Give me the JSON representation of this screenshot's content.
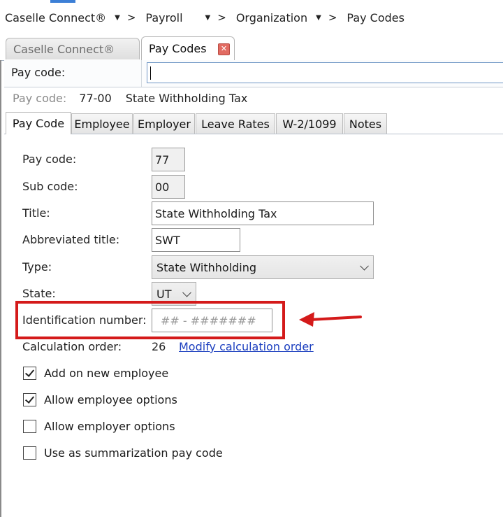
{
  "breadcrumb": [
    {
      "label": "Caselle Connect®"
    },
    {
      "label": "Payroll"
    },
    {
      "label": "Organization"
    },
    {
      "label": "Pay Codes"
    }
  ],
  "breadcrumb_separator": ">",
  "document_tabs": [
    {
      "label": "Caselle Connect®",
      "active": false
    },
    {
      "label": "Pay Codes",
      "active": true
    }
  ],
  "lookup": {
    "label": "Pay code:",
    "value": ""
  },
  "summary": {
    "label": "Pay code:",
    "code": "77-00",
    "title": "State Withholding Tax"
  },
  "form_tabs": [
    "Pay Code",
    "Employee",
    "Employer",
    "Leave Rates",
    "W-2/1099",
    "Notes"
  ],
  "fields": {
    "pay_code": {
      "label": "Pay code:",
      "value": "77"
    },
    "sub_code": {
      "label": "Sub code:",
      "value": "00"
    },
    "title": {
      "label": "Title:",
      "value": "State Withholding Tax"
    },
    "abbreviated_title": {
      "label": "Abbreviated title:",
      "value": "SWT"
    },
    "type": {
      "label": "Type:",
      "value": "State Withholding"
    },
    "state": {
      "label": "State:",
      "value": "UT"
    },
    "identification_number": {
      "label": "Identification number:",
      "placeholder": "## - #######"
    },
    "calculation_order": {
      "label": "Calculation order:",
      "value": "26",
      "link": "Modify calculation order"
    }
  },
  "checkboxes": [
    {
      "label": "Add on new employee",
      "checked": true
    },
    {
      "label": "Allow employee options",
      "checked": true
    },
    {
      "label": "Allow employer options",
      "checked": false
    },
    {
      "label": "Use as summarization pay code",
      "checked": false
    }
  ],
  "colors": {
    "highlight": "#d41a1a",
    "link": "#1c3fbf",
    "close_icon": "#e26b62"
  }
}
